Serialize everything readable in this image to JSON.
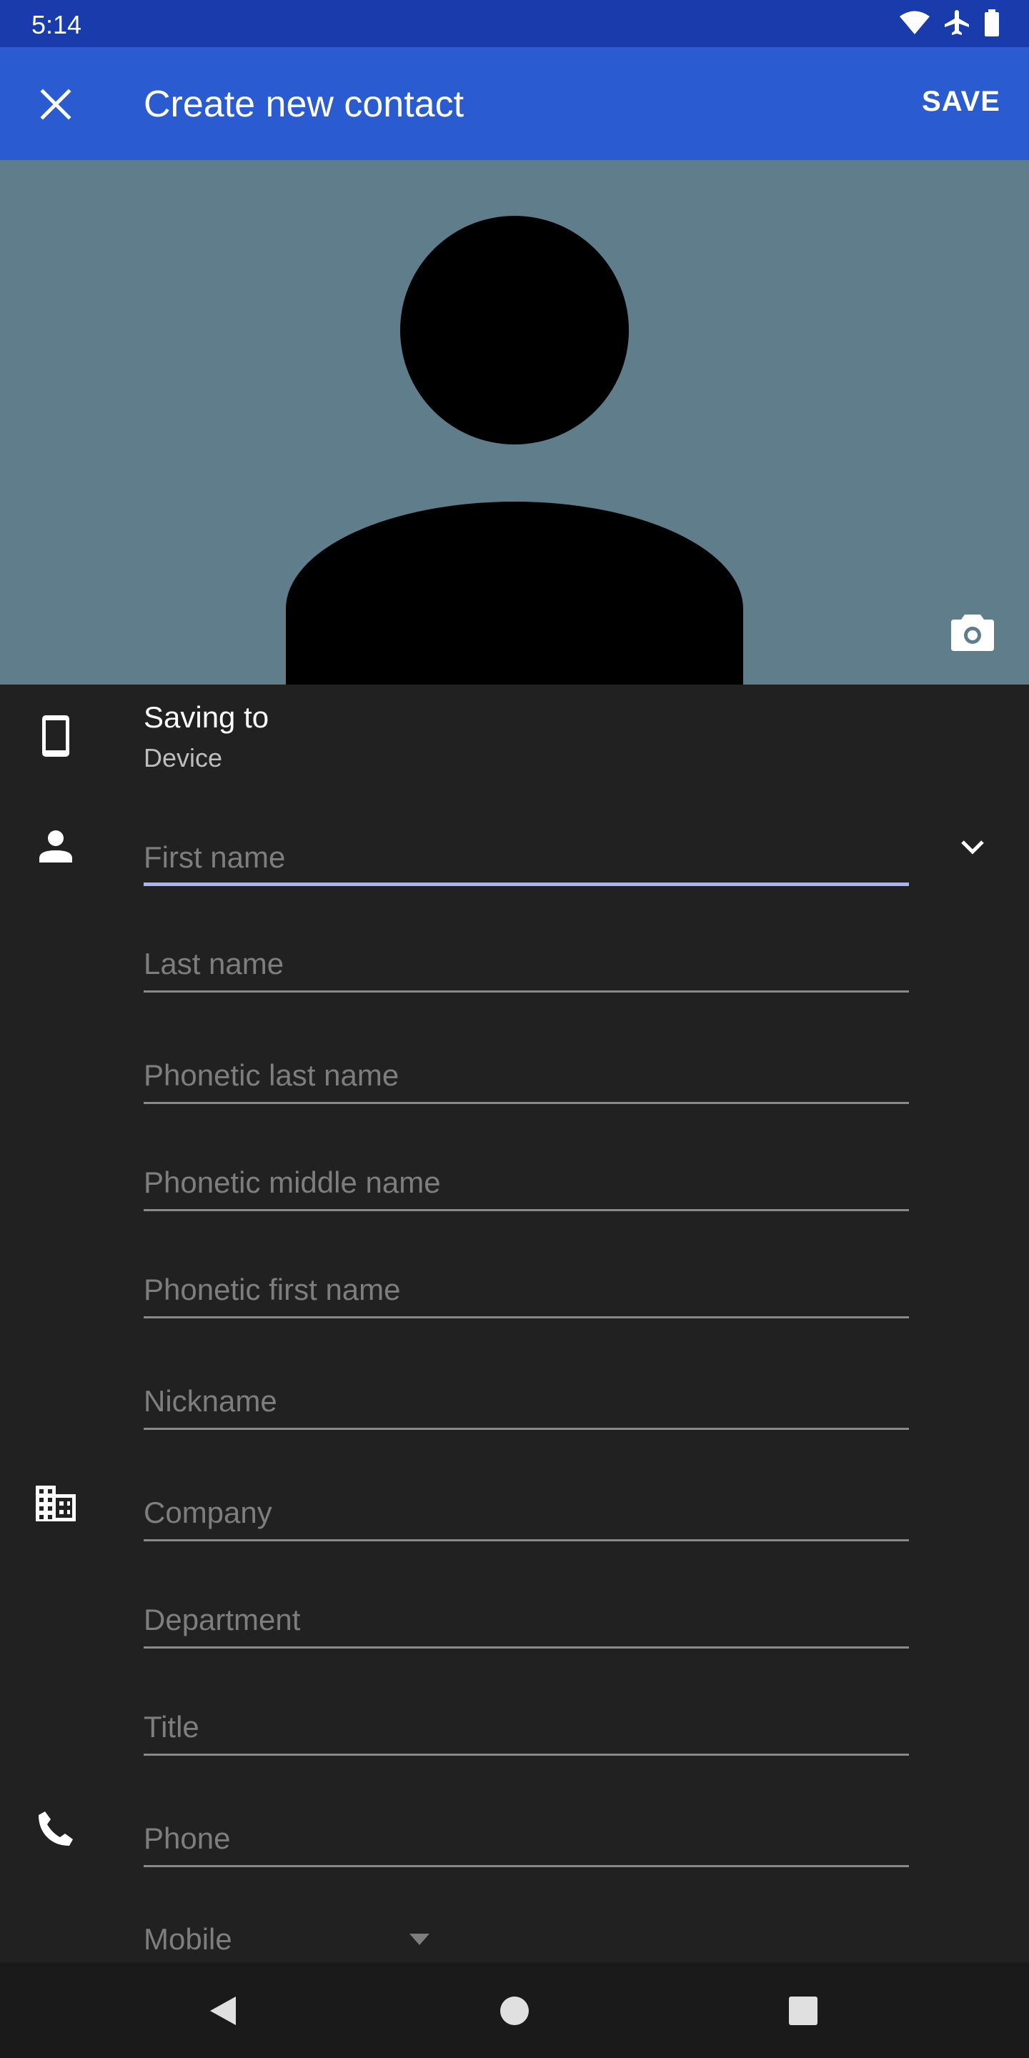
{
  "status_bar": {
    "time": "5:14",
    "icons": [
      "wifi-icon",
      "airplane-icon",
      "battery-icon"
    ]
  },
  "app_bar": {
    "title": "Create new contact",
    "save_label": "SAVE",
    "close_icon": "close-icon",
    "background_color": "#2b5bd0"
  },
  "photo": {
    "background_color": "#607d8b",
    "camera_icon": "camera-icon"
  },
  "account": {
    "label": "Saving to",
    "value": "Device",
    "icon": "phone-device-icon"
  },
  "fields": {
    "first_name": {
      "placeholder": "First name",
      "value": ""
    },
    "last_name": {
      "placeholder": "Last name",
      "value": ""
    },
    "phonetic_last_name": {
      "placeholder": "Phonetic last name",
      "value": ""
    },
    "phonetic_middle_name": {
      "placeholder": "Phonetic middle name",
      "value": ""
    },
    "phonetic_first_name": {
      "placeholder": "Phonetic first name",
      "value": ""
    },
    "nickname": {
      "placeholder": "Nickname",
      "value": ""
    },
    "company": {
      "placeholder": "Company",
      "value": ""
    },
    "department": {
      "placeholder": "Department",
      "value": ""
    },
    "title": {
      "placeholder": "Title",
      "value": ""
    },
    "phone": {
      "placeholder": "Phone",
      "value": ""
    }
  },
  "phone_type": {
    "selected": "Mobile"
  },
  "nav_bar": {
    "icons": [
      "back-icon",
      "home-icon",
      "recents-icon"
    ]
  }
}
